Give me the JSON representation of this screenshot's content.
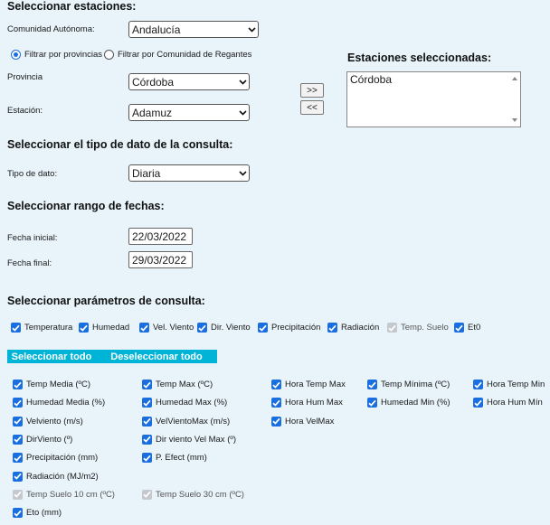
{
  "sections": {
    "stations": "Seleccionar estaciones:",
    "datatype": "Seleccionar el tipo de dato de la consulta:",
    "dates": "Seleccionar rango de fechas:",
    "params": "Seleccionar parámetros de consulta:"
  },
  "stations": {
    "comunidad_label": "Comunidad Autónoma:",
    "comunidad_value": "Andalucía",
    "radio_provincias": "Filtrar por provincias",
    "radio_regantes": "Filtrar por Comunidad de Regantes",
    "provincia_label": "Provincia",
    "provincia_value": "Córdoba",
    "estacion_label": "Estación:",
    "estacion_value": "Adamuz",
    "add_label": ">>",
    "remove_label": "<<",
    "selected_title": "Estaciones seleccionadas:",
    "selected_items": [
      "Córdoba"
    ]
  },
  "datatype": {
    "label": "Tipo de dato:",
    "value": "Diaria"
  },
  "dates": {
    "start_label": "Fecha inicial:",
    "start_value": "22/03/2022",
    "end_label": "Fecha final:",
    "end_value": "29/03/2022"
  },
  "categories": [
    {
      "label": "Temperatura",
      "checked": true,
      "disabled": false
    },
    {
      "label": "Humedad",
      "checked": true,
      "disabled": false
    },
    {
      "label": "Vel. Viento",
      "checked": true,
      "disabled": false
    },
    {
      "label": "Dir. Viento",
      "checked": true,
      "disabled": false
    },
    {
      "label": "Precipitación",
      "checked": true,
      "disabled": false
    },
    {
      "label": "Radiación",
      "checked": true,
      "disabled": false
    },
    {
      "label": "Temp. Suelo",
      "checked": true,
      "disabled": true
    },
    {
      "label": "Et0",
      "checked": true,
      "disabled": false
    }
  ],
  "buttons": {
    "select_all": "Seleccionar todo",
    "deselect_all": "Deseleccionar todo"
  },
  "params": {
    "col1": [
      {
        "label": "Temp Media (ºC)",
        "disabled": false
      },
      {
        "label": "Humedad Media (%)",
        "disabled": false
      },
      {
        "label": "Velviento (m/s)",
        "disabled": false
      },
      {
        "label": "DirViento (º)",
        "disabled": false
      },
      {
        "label": "Precipitación (mm)",
        "disabled": false
      },
      {
        "label": "Radiación (MJ/m2)",
        "disabled": false
      },
      {
        "label": "Temp Suelo 10 cm (ºC)",
        "disabled": true
      },
      {
        "label": "Eto (mm)",
        "disabled": false
      }
    ],
    "col2": [
      {
        "label": "Temp Max (ºC)",
        "disabled": false
      },
      {
        "label": "Humedad Max (%)",
        "disabled": false
      },
      {
        "label": "VelVientoMax (m/s)",
        "disabled": false
      },
      {
        "label": "Dir viento Vel Max (º)",
        "disabled": false
      },
      {
        "label": "P. Efect (mm)",
        "disabled": false
      },
      {
        "label": "",
        "disabled": false
      },
      {
        "label": "Temp Suelo 30 cm (ºC)",
        "disabled": true
      }
    ],
    "col3": [
      {
        "label": "Hora Temp Max",
        "disabled": false
      },
      {
        "label": "Hora Hum Max",
        "disabled": false
      },
      {
        "label": "Hora VelMax",
        "disabled": false
      }
    ],
    "col4": [
      {
        "label": "Temp Mínima (ºC)",
        "disabled": false
      },
      {
        "label": "Humedad Min (%)",
        "disabled": false
      }
    ],
    "col5": [
      {
        "label": "Hora Temp Min",
        "disabled": false
      },
      {
        "label": "Hora Hum Mín",
        "disabled": false
      }
    ]
  }
}
